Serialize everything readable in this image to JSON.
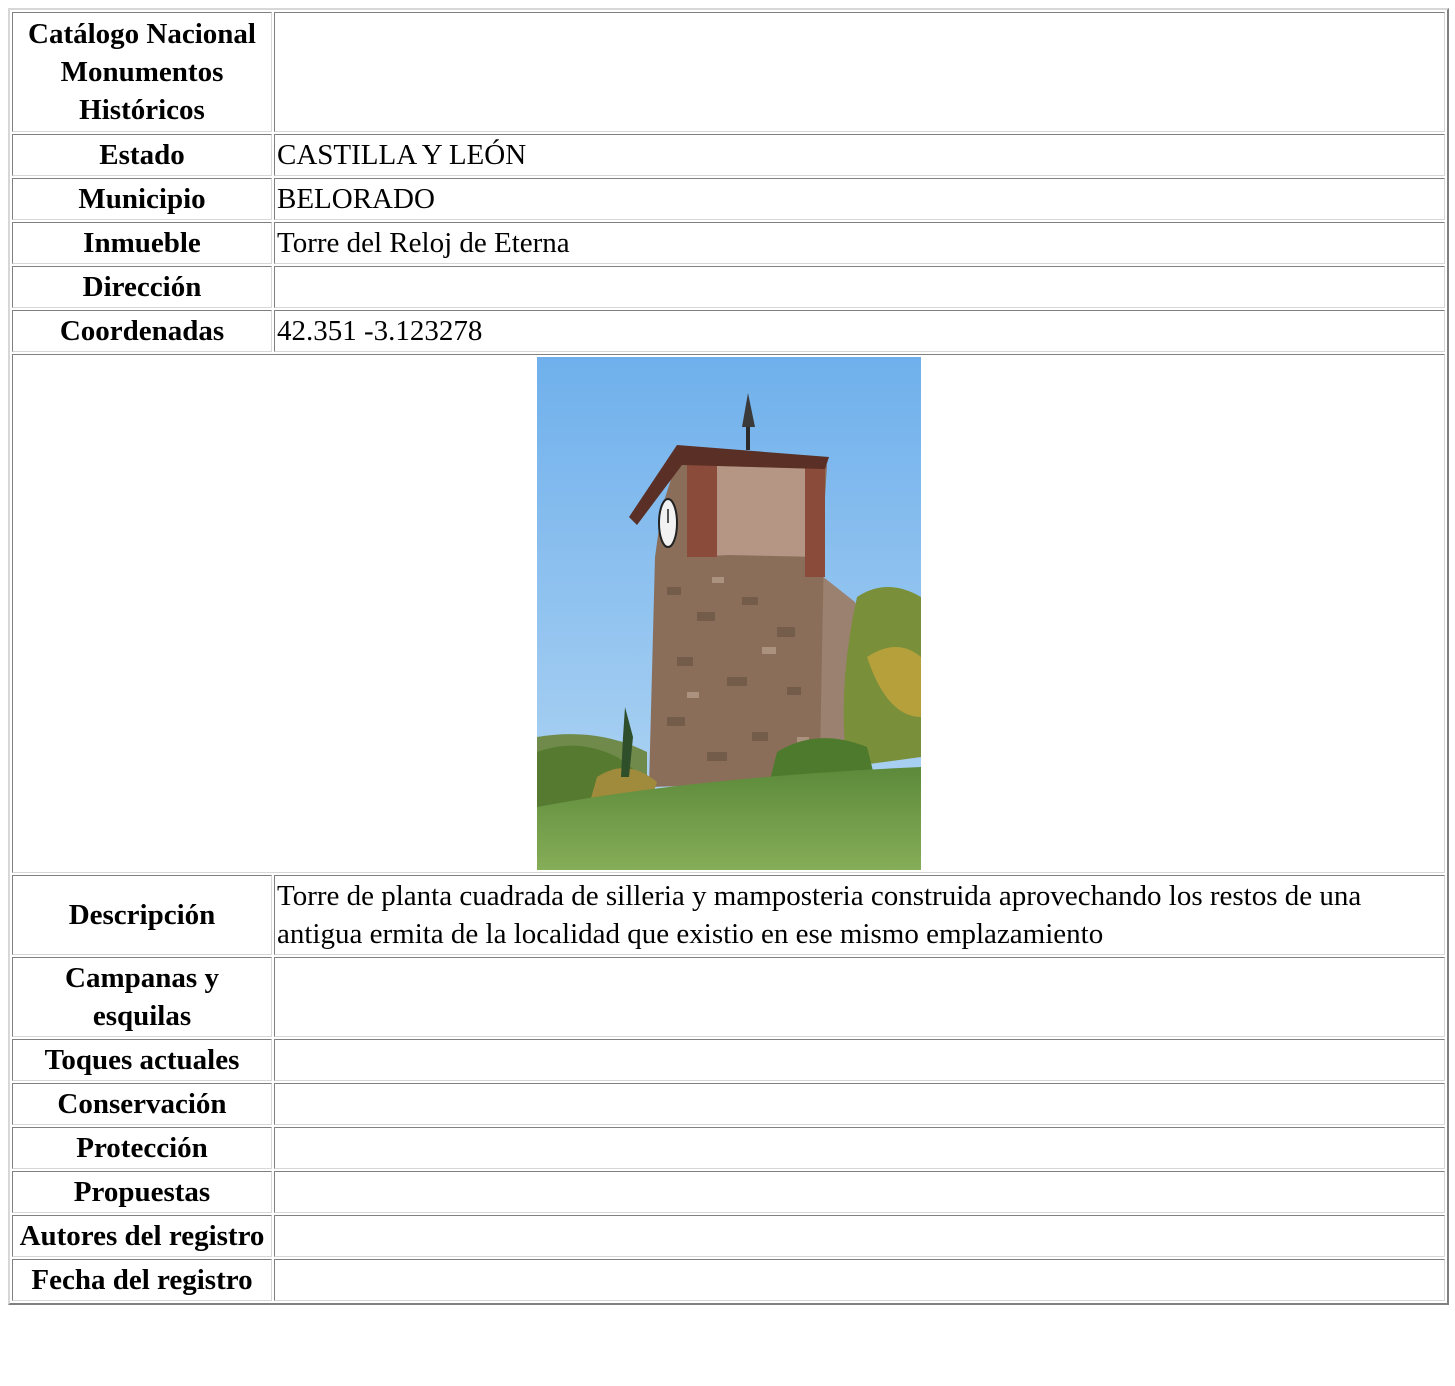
{
  "record": {
    "header_label": "Catálogo Nacional Monumentos Históricos",
    "rows": [
      {
        "label": "Estado",
        "value": "CASTILLA Y LEÓN"
      },
      {
        "label": "Municipio",
        "value": "BELORADO"
      },
      {
        "label": "Inmueble",
        "value": "Torre del Reloj de Eterna"
      },
      {
        "label": "Dirección",
        "value": ""
      },
      {
        "label": "Coordenadas",
        "value": "42.351 -3.123278"
      }
    ],
    "photo": {
      "subject": "clock-tower-photo",
      "colors": {
        "sky": "#8ec2ee",
        "grass": "#6e9a44",
        "stone": "#8a6e5a",
        "roof": "#5a2f25"
      }
    },
    "rows_after_photo": [
      {
        "label": "Descripción",
        "value": "Torre de planta cuadrada de silleria y mamposteria construida aprovechando los restos de una antigua ermita de la localidad que existio en ese mismo emplazamiento"
      },
      {
        "label": "Campanas y esquilas",
        "value": ""
      },
      {
        "label": "Toques actuales",
        "value": ""
      },
      {
        "label": "Conservación",
        "value": ""
      },
      {
        "label": "Protección",
        "value": ""
      },
      {
        "label": "Propuestas",
        "value": ""
      },
      {
        "label": "Autores del registro",
        "value": ""
      },
      {
        "label": "Fecha del registro",
        "value": ""
      }
    ]
  }
}
